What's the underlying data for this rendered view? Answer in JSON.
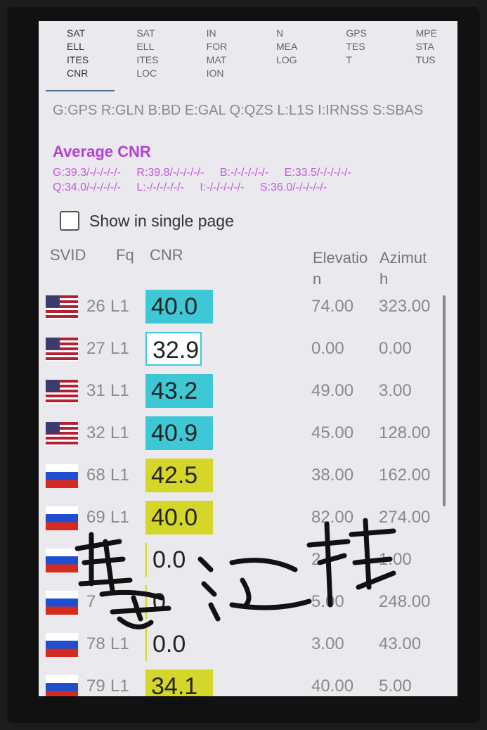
{
  "tabs": [
    {
      "label": "SAT\nELL\nITES\nCNR",
      "active": true
    },
    {
      "label": "SAT\nELL\nITES\nLOC",
      "active": false
    },
    {
      "label": "IN\nFOR\nMAT\nION",
      "active": false
    },
    {
      "label": "N\nMEA\nLOG",
      "active": false
    },
    {
      "label": "GPS\nTES\nT",
      "active": false
    },
    {
      "label": "MPE\nSTA\nTUS",
      "active": false
    }
  ],
  "legend": "G:GPS R:GLN B:BD E:GAL Q:QZS L:L1S I:IRNSS S:SBAS",
  "average": {
    "title": "Average CNR",
    "values": [
      "G:39.3/-/-/-/-/-",
      "R:39.8/-/-/-/-/-",
      "B:-/-/-/-/-/-",
      "E:33.5/-/-/-/-/-",
      "Q:34.0/-/-/-/-/-",
      "L:-/-/-/-/-/-",
      "I:-/-/-/-/-/-",
      "S:36.0/-/-/-/-/-"
    ]
  },
  "single_page": {
    "label": "Show in single page",
    "checked": false
  },
  "columns": {
    "svid": "SVID",
    "fq": "Fq",
    "cnr": "CNR",
    "elevation": "Elevatio\nn",
    "azimuth": "Azimut\nh"
  },
  "satellites": [
    {
      "flag": "us-flag",
      "svid": "26",
      "fq": "L1",
      "cnr": "40.0",
      "style": "cyan",
      "elevation": "74.00",
      "azimuth": "323.00"
    },
    {
      "flag": "us-flag",
      "svid": "27",
      "fq": "L1",
      "cnr": "32.9",
      "style": "outlined",
      "elevation": "0.00",
      "azimuth": "0.00"
    },
    {
      "flag": "us-flag",
      "svid": "31",
      "fq": "L1",
      "cnr": "43.2",
      "style": "cyan",
      "elevation": "49.00",
      "azimuth": "3.00"
    },
    {
      "flag": "us-flag",
      "svid": "32",
      "fq": "L1",
      "cnr": "40.9",
      "style": "cyan",
      "elevation": "45.00",
      "azimuth": "128.00"
    },
    {
      "flag": "ru-flag",
      "svid": "68",
      "fq": "L1",
      "cnr": "42.5",
      "style": "yellow",
      "elevation": "38.00",
      "azimuth": "162.00"
    },
    {
      "flag": "ru-flag",
      "svid": "69",
      "fq": "L1",
      "cnr": "40.0",
      "style": "yellow",
      "elevation": "82.00",
      "azimuth": "274.00"
    },
    {
      "flag": "ru-flag",
      "svid": "",
      "fq": "",
      "cnr": "0.0",
      "style": "plain",
      "elevation": "2",
      "azimuth": "1.00"
    },
    {
      "flag": "ru-flag",
      "svid": "7",
      "fq": "",
      "cnr": "0",
      "style": "plain",
      "elevation": "5.00",
      "azimuth": "248.00"
    },
    {
      "flag": "ru-flag",
      "svid": "78",
      "fq": "L1",
      "cnr": "0.0",
      "style": "plain",
      "elevation": "3.00",
      "azimuth": "43.00"
    },
    {
      "flag": "ru-flag",
      "svid": "79",
      "fq": "L1",
      "cnr": "34.1",
      "style": "yellow",
      "elevation": "40.00",
      "azimuth": "5.00"
    }
  ],
  "colors": {
    "cyan": "#3ec8d6",
    "yellow": "#d4d72a",
    "purple": "#b43fd6"
  }
}
